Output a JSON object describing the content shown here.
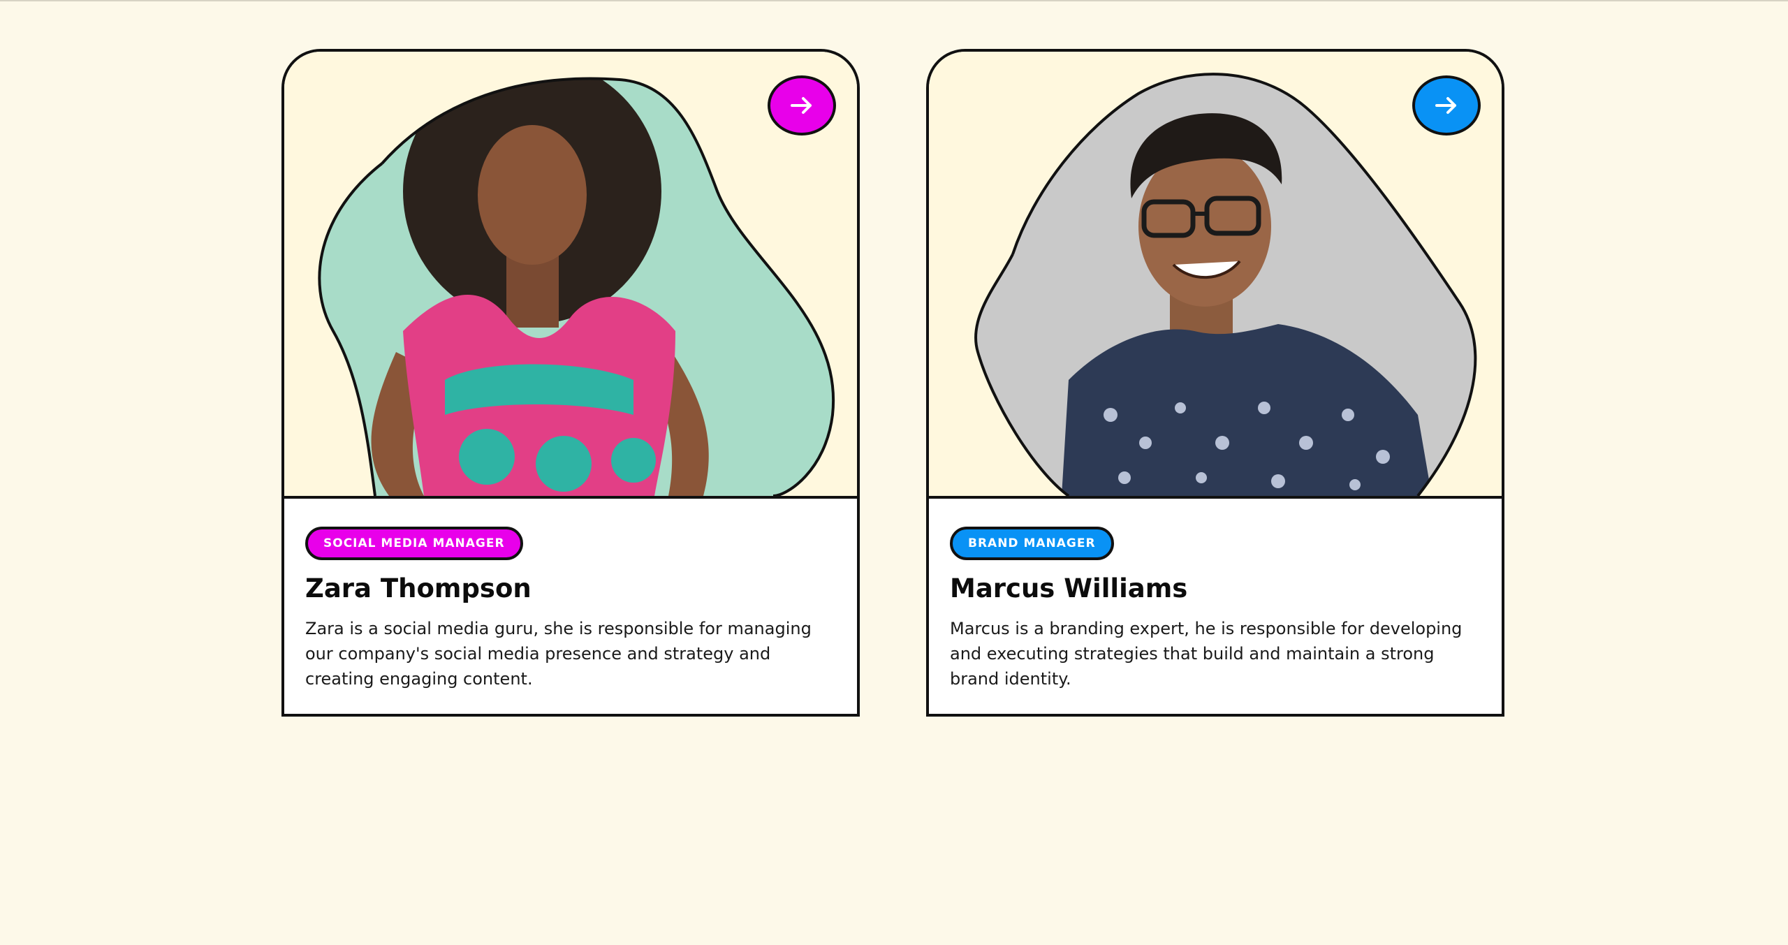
{
  "colors": {
    "page_background": "#fdf9e9",
    "card_media_background": "#fff8de",
    "accent_magenta": "#e800ea",
    "accent_blue": "#0992f5",
    "outline": "#111111"
  },
  "team": [
    {
      "role": "SOCIAL MEDIA MANAGER",
      "name": "Zara Thompson",
      "description": "Zara is a social media guru, she is responsible for managing our company's social media presence and strategy and creating engaging content.",
      "accent": "#e800ea",
      "photo": "portrait-photo-woman",
      "action_icon": "arrow-right-icon"
    },
    {
      "role": "BRAND MANAGER",
      "name": "Marcus Williams",
      "description": "Marcus is a branding expert, he is responsible for developing and executing strategies that build and maintain a strong brand identity.",
      "accent": "#0992f5",
      "photo": "portrait-photo-man",
      "action_icon": "arrow-right-icon"
    }
  ]
}
